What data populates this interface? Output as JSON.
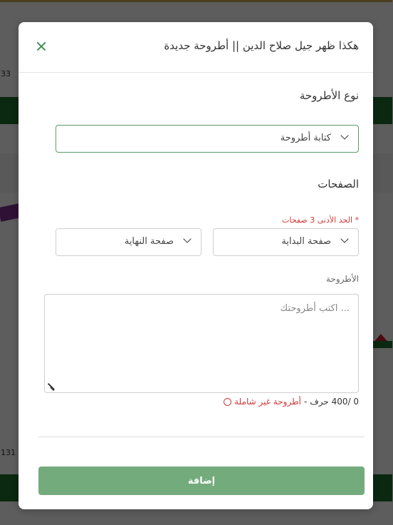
{
  "modal": {
    "title": "هكذا ظهر جيل صلاح الدين || أطروحة جديدة",
    "type_section": {
      "label": "نوع الأطروحة",
      "selected": "كتابة أطروحة"
    },
    "pages_section": {
      "label": "الصفحات",
      "hint": "* الحد الأدنى 3 صفحات",
      "start_page": "صفحة البداية",
      "end_page": "صفحة النهاية"
    },
    "thesis_section": {
      "label": "الأطروحة",
      "placeholder": "... اكتب أطروحتك",
      "counter": "0 /400 حرف",
      "separator": "-",
      "warning": "أطروحة غير شاملة"
    },
    "submit_label": "إضافة"
  },
  "background": {
    "numbers": [
      "33",
      "131"
    ]
  },
  "colors": {
    "accent": "#74ab7c",
    "border_active": "#5a9a6a",
    "error": "#d23a3a",
    "brand_dark": "#1f6b2e"
  }
}
